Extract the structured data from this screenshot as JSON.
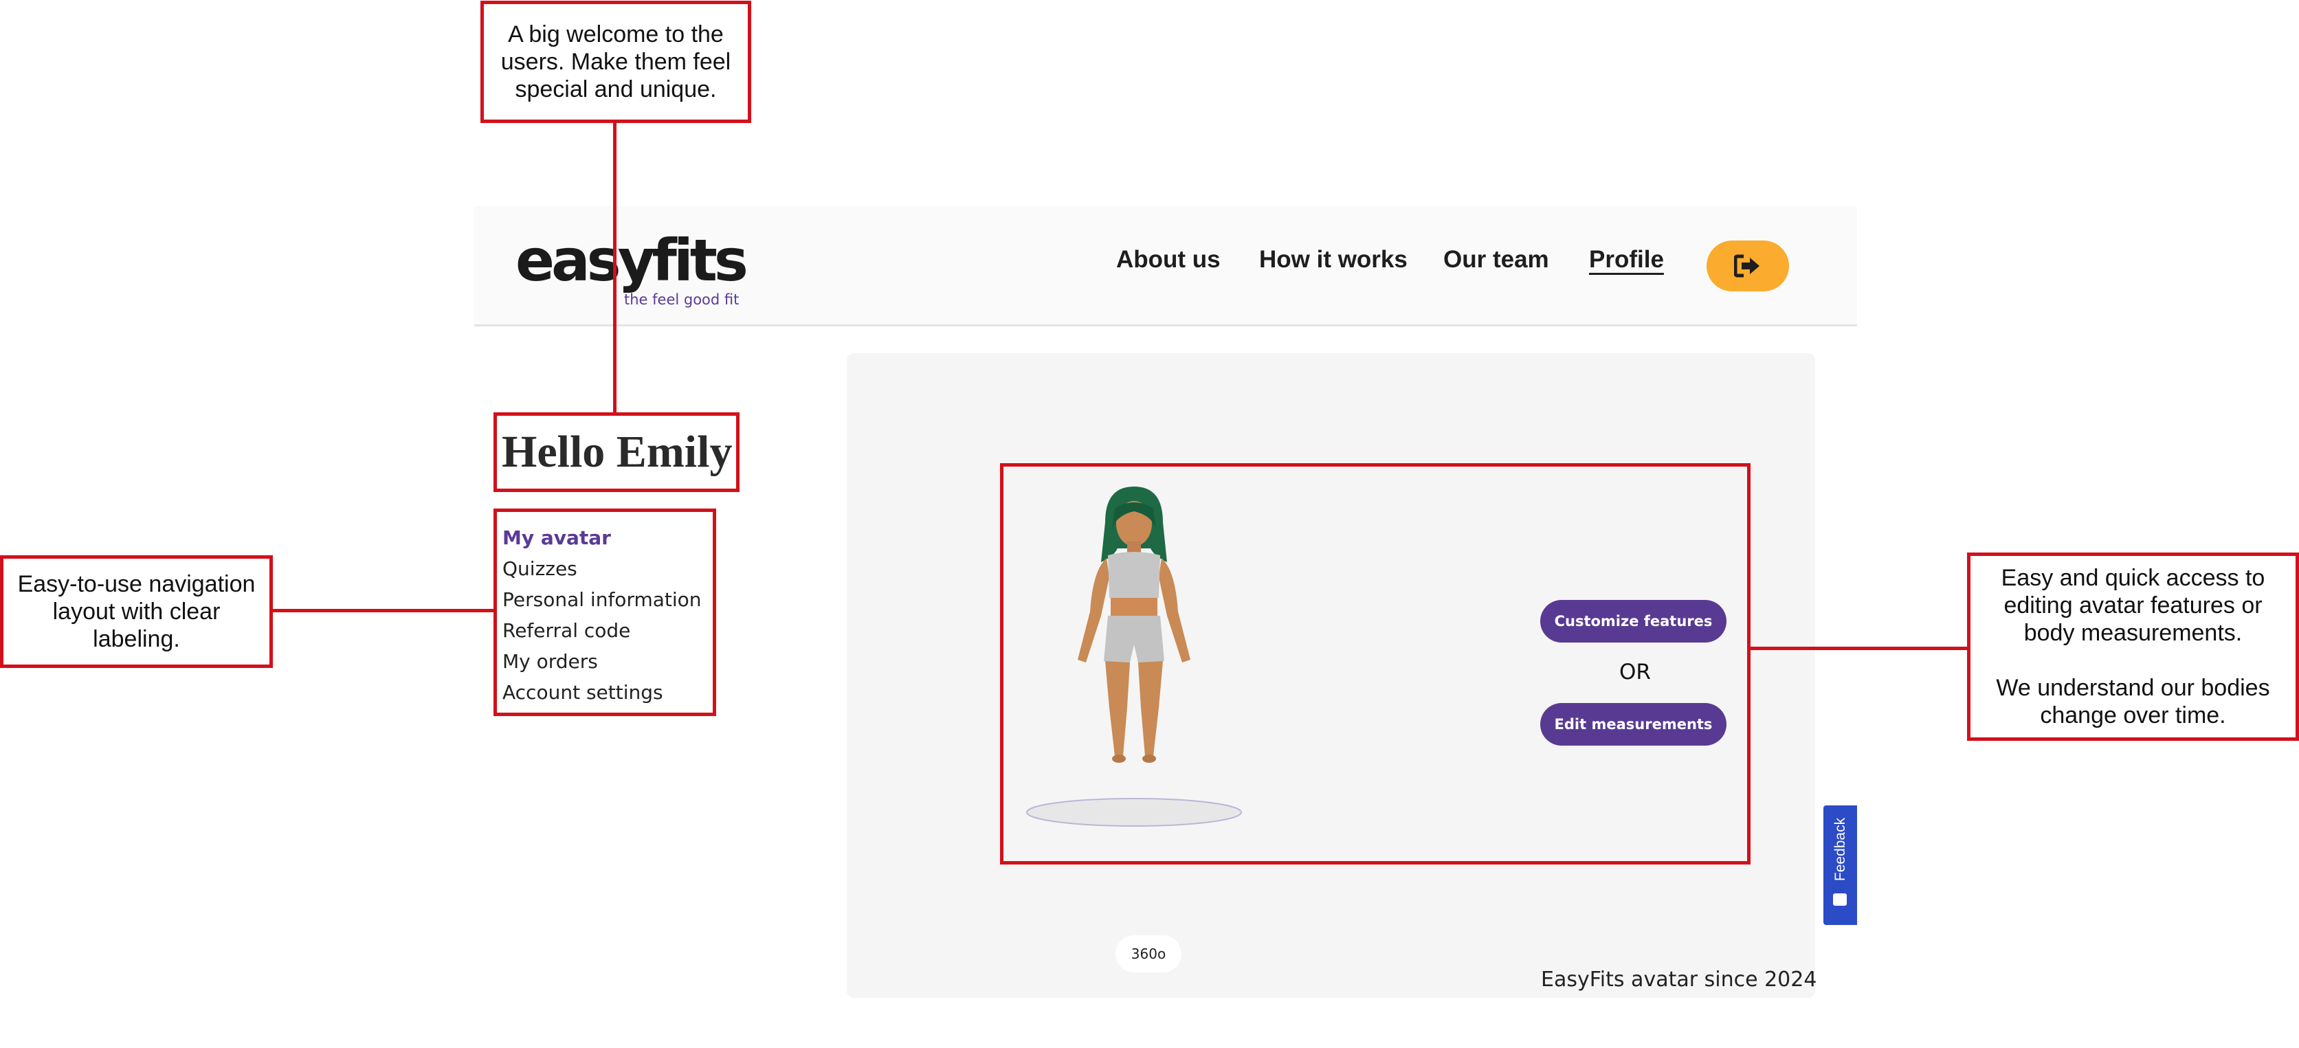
{
  "header": {
    "logo_text": "easyfits",
    "logo_tagline": "the feel good fit",
    "nav": [
      "About us",
      "How it works",
      "Our team",
      "Profile"
    ],
    "active_nav": "Profile",
    "logout_icon": "sign-out-icon"
  },
  "greeting": "Hello Emily",
  "sidebar": {
    "items": [
      "My avatar",
      "Quizzes",
      "Personal information",
      "Referral code",
      "My orders",
      "Account settings"
    ],
    "active": "My avatar"
  },
  "avatar_panel": {
    "customize_label": "Customize features",
    "or_label": "OR",
    "edit_label": "Edit measurements",
    "rotate_label": "360o",
    "since_label": "EasyFits avatar since 2024",
    "feedback_label": "Feedback"
  },
  "annotations": {
    "welcome": "A big welcome to the\nusers. Make them feel\nspecial and unique.",
    "navigation": "Easy-to-use navigation\nlayout with clear\nlabeling.",
    "edit_access": "Easy and quick access to\nediting avatar features or\nbody measurements.\n\nWe understand our bodies\nchange over time."
  },
  "colors": {
    "brand_purple": "#583a93",
    "logout_orange": "#fbab2d",
    "feedback_blue": "#2c4bc7",
    "annotation_red": "#d3101a"
  }
}
